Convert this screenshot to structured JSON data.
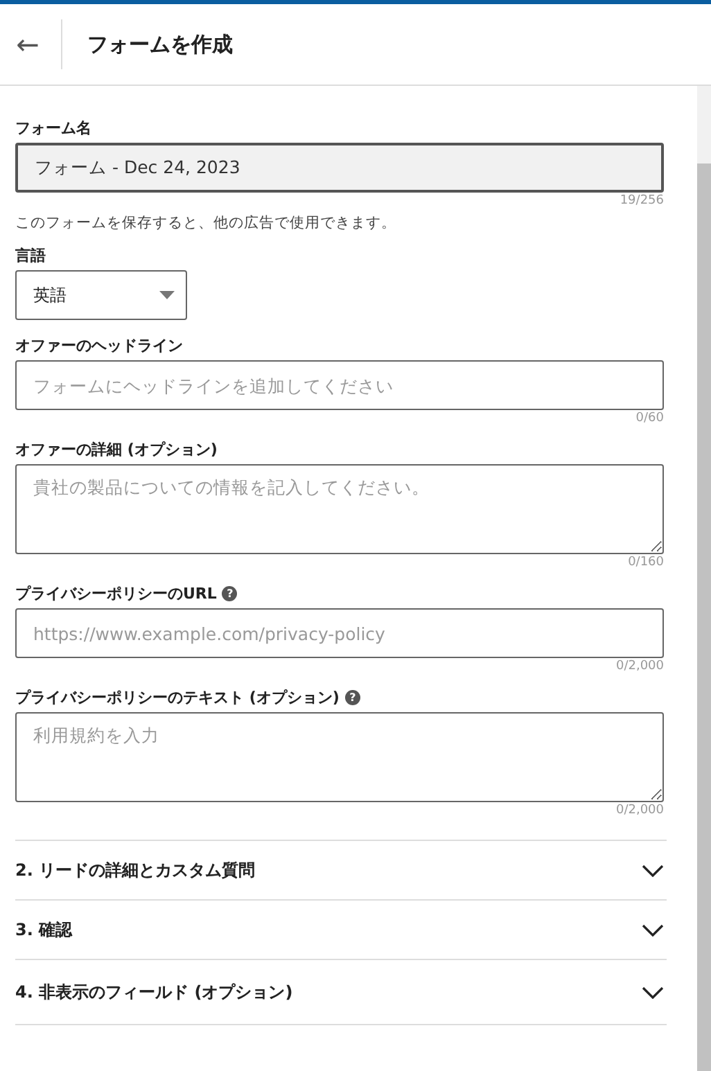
{
  "header": {
    "back_icon": "←",
    "title": "フォームを作成"
  },
  "fields": [
    {
      "kind": "text",
      "label": "フォーム名",
      "value": "フォーム - Dec 24, 2023",
      "disabled": true,
      "counter": "19/256",
      "helper": "このフォームを保存すると、他の広告で使用できます。"
    },
    {
      "kind": "select",
      "label": "言語",
      "value": "英語"
    },
    {
      "kind": "text",
      "label": "オファーのヘッドライン",
      "placeholder": "フォームにヘッドラインを追加してください",
      "disabled": false,
      "counter": "0/60"
    },
    {
      "kind": "textarea",
      "label": "オファーの詳細 (オプション)",
      "placeholder": "貴社の製品についての情報を記入してください。",
      "counter": "0/160"
    },
    {
      "kind": "text",
      "label": "プライバシーポリシーのURL",
      "help": "?",
      "placeholder": "https://www.example.com/privacy-policy",
      "disabled": false,
      "counter": "0/2,000"
    },
    {
      "kind": "textarea",
      "label": "プライバシーポリシーのテキスト (オプション)",
      "help": "?",
      "placeholder": "利用規約を入力",
      "counter": "0/2,000"
    }
  ],
  "sections": [
    {
      "title": "2. リードの詳細とカスタム質問",
      "expanded": false
    },
    {
      "title": "3. 確認",
      "expanded": false
    },
    {
      "title": "4. 非表示のフィールド (オプション)",
      "expanded": false
    }
  ]
}
